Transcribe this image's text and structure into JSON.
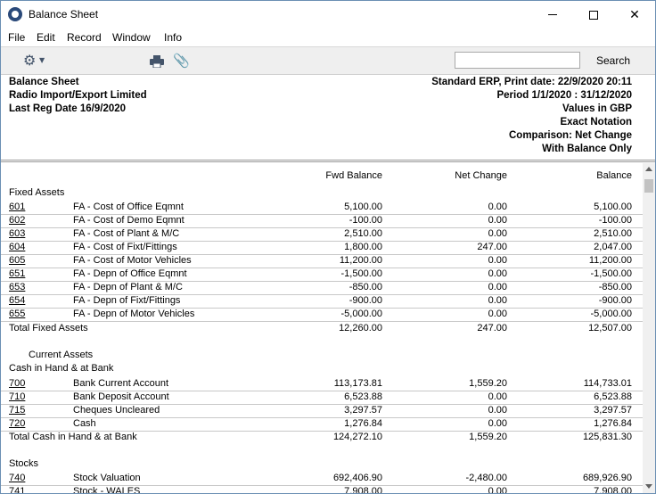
{
  "window": {
    "title": "Balance Sheet"
  },
  "menu": [
    "File",
    "Edit",
    "Record",
    "Window",
    "Info"
  ],
  "toolbar": {
    "search_value": "",
    "search_label": "Search"
  },
  "header": {
    "left": [
      "Balance Sheet",
      "Radio Import/Export Limited",
      "Last Reg Date  16/9/2020"
    ],
    "right": [
      "Standard ERP, Print date: 22/9/2020 20:11",
      "Period  1/1/2020 : 31/12/2020",
      "Values in GBP",
      "Exact Notation",
      "Comparison: Net Change",
      "With Balance Only"
    ]
  },
  "columns": {
    "fwd": "Fwd Balance",
    "net": "Net Change",
    "bal": "Balance"
  },
  "rows": [
    {
      "type": "section",
      "label": "Fixed Assets"
    },
    {
      "type": "account",
      "acc": "601",
      "name": "FA - Cost of Office Eqmnt",
      "fwd": "5,100.00",
      "net": "0.00",
      "bal": "5,100.00"
    },
    {
      "type": "account",
      "acc": "602",
      "name": "FA - Cost of Demo Eqmnt",
      "fwd": "-100.00",
      "net": "0.00",
      "bal": "-100.00"
    },
    {
      "type": "account",
      "acc": "603",
      "name": "FA - Cost of Plant & M/C",
      "fwd": "2,510.00",
      "net": "0.00",
      "bal": "2,510.00"
    },
    {
      "type": "account",
      "acc": "604",
      "name": "FA - Cost of Fixt/Fittings",
      "fwd": "1,800.00",
      "net": "247.00",
      "bal": "2,047.00"
    },
    {
      "type": "account",
      "acc": "605",
      "name": "FA - Cost of Motor Vehicles",
      "fwd": "11,200.00",
      "net": "0.00",
      "bal": "11,200.00"
    },
    {
      "type": "account",
      "acc": "651",
      "name": "FA - Depn of Office Eqmnt",
      "fwd": "-1,500.00",
      "net": "0.00",
      "bal": "-1,500.00"
    },
    {
      "type": "account",
      "acc": "653",
      "name": "FA - Depn of Plant & M/C",
      "fwd": "-850.00",
      "net": "0.00",
      "bal": "-850.00"
    },
    {
      "type": "account",
      "acc": "654",
      "name": "FA - Depn of Fixt/Fittings",
      "fwd": "-900.00",
      "net": "0.00",
      "bal": "-900.00"
    },
    {
      "type": "account",
      "acc": "655",
      "name": "FA - Depn of Motor Vehicles",
      "fwd": "-5,000.00",
      "net": "0.00",
      "bal": "-5,000.00"
    },
    {
      "type": "total",
      "label": "Total Fixed Assets",
      "fwd": "12,260.00",
      "net": "247.00",
      "bal": "12,507.00"
    },
    {
      "type": "blank"
    },
    {
      "type": "subsection",
      "label": "Current Assets"
    },
    {
      "type": "section",
      "label": "Cash in Hand & at Bank"
    },
    {
      "type": "account",
      "acc": "700",
      "name": "Bank Current Account",
      "fwd": "113,173.81",
      "net": "1,559.20",
      "bal": "114,733.01"
    },
    {
      "type": "account",
      "acc": "710",
      "name": "Bank Deposit Account",
      "fwd": "6,523.88",
      "net": "0.00",
      "bal": "6,523.88"
    },
    {
      "type": "account",
      "acc": "715",
      "name": "Cheques Uncleared",
      "fwd": "3,297.57",
      "net": "0.00",
      "bal": "3,297.57"
    },
    {
      "type": "account",
      "acc": "720",
      "name": "Cash",
      "fwd": "1,276.84",
      "net": "0.00",
      "bal": "1,276.84"
    },
    {
      "type": "total",
      "label": "Total Cash in Hand & at Bank",
      "fwd": "124,272.10",
      "net": "1,559.20",
      "bal": "125,831.30"
    },
    {
      "type": "blank"
    },
    {
      "type": "section",
      "label": "Stocks"
    },
    {
      "type": "account",
      "acc": "740",
      "name": "Stock Valuation",
      "fwd": "692,406.90",
      "net": "-2,480.00",
      "bal": "689,926.90"
    },
    {
      "type": "account",
      "acc": "741",
      "name": "Stock - WALES",
      "fwd": "7,908.00",
      "net": "0.00",
      "bal": "7,908.00"
    }
  ]
}
